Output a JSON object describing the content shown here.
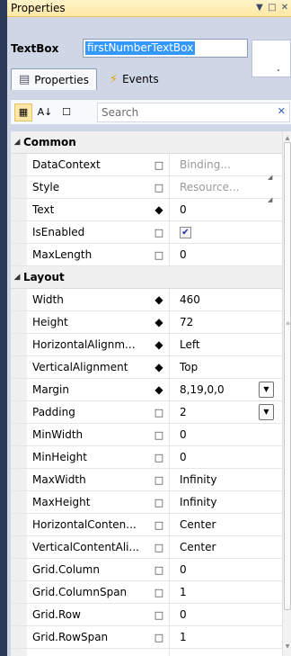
{
  "panel_title": "Properties",
  "title_controls": {
    "dropdown": "▼",
    "restore": "□",
    "close": "✕"
  },
  "element_type": "TextBox",
  "element_name": "firstNumberTextBox",
  "tabs": [
    {
      "label": "Properties",
      "active": true
    },
    {
      "label": "Events",
      "active": false
    }
  ],
  "toolbar": {
    "categorize_icon": "categorize-icon",
    "sort_icon": "sort-az-icon",
    "filter_icon": "filter-icon",
    "search_placeholder": "Search",
    "clear_icon": "✕"
  },
  "categories": [
    {
      "name": "Common",
      "properties": [
        {
          "name": "DataContext",
          "marker": "□",
          "value": "Binding...",
          "gray": true
        },
        {
          "name": "Style",
          "marker": "□",
          "value": "Resource...",
          "gray": true
        },
        {
          "name": "Text",
          "marker": "◆",
          "value": "0"
        },
        {
          "name": "IsEnabled",
          "marker": "□",
          "checkbox": true,
          "checked": true
        },
        {
          "name": "MaxLength",
          "marker": "□",
          "value": "0"
        }
      ]
    },
    {
      "name": "Layout",
      "properties": [
        {
          "name": "Width",
          "marker": "◆",
          "value": "460"
        },
        {
          "name": "Height",
          "marker": "◆",
          "value": "72"
        },
        {
          "name": "HorizontalAlignm...",
          "marker": "◆",
          "value": "Left"
        },
        {
          "name": "VerticalAlignment",
          "marker": "◆",
          "value": "Top"
        },
        {
          "name": "Margin",
          "marker": "◆",
          "value": "8,19,0,0",
          "dropdown": true
        },
        {
          "name": "Padding",
          "marker": "□",
          "value": "2",
          "dropdown": true
        },
        {
          "name": "MinWidth",
          "marker": "□",
          "value": "0"
        },
        {
          "name": "MinHeight",
          "marker": "□",
          "value": "0"
        },
        {
          "name": "MaxWidth",
          "marker": "□",
          "value": "Infinity"
        },
        {
          "name": "MaxHeight",
          "marker": "□",
          "value": "Infinity"
        },
        {
          "name": "HorizontalConten...",
          "marker": "□",
          "value": "Center"
        },
        {
          "name": "VerticalContentAli...",
          "marker": "□",
          "value": "Center"
        },
        {
          "name": "Grid.Column",
          "marker": "□",
          "value": "0"
        },
        {
          "name": "Grid.ColumnSpan",
          "marker": "□",
          "value": "1"
        },
        {
          "name": "Grid.Row",
          "marker": "□",
          "value": "0"
        },
        {
          "name": "Grid.RowSpan",
          "marker": "□",
          "value": "1"
        }
      ]
    }
  ]
}
